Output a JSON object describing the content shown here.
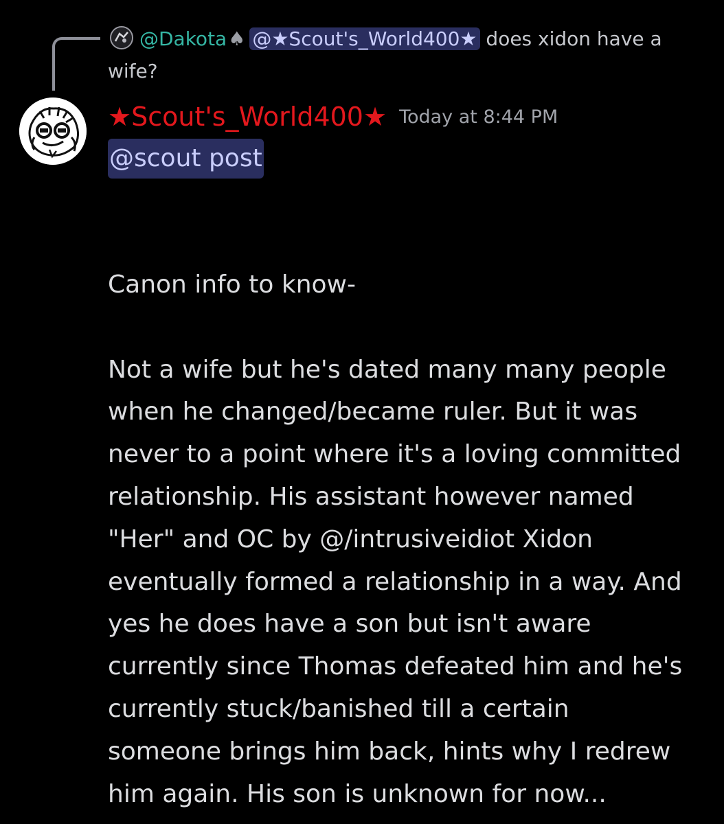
{
  "reply": {
    "author": "@Dakota",
    "author_badge": "♠",
    "mention": "@★Scout's_World400★",
    "text_part1": " does xidon have a",
    "text_part2": "wife?"
  },
  "message": {
    "author": "★Scout's_World400★",
    "author_color": "#e3181d",
    "timestamp": "Today at 8:44 PM",
    "role_mention": "@scout post",
    "heading": "Canon info to know-",
    "body": "Not a wife but he's dated many many people\nwhen he changed/became ruler. But it was\nnever to a point where it's a loving committed\nrelationship. His assistant however named\n\"Her\" and OC by @/intrusiveidiot  Xidon\neventually formed a relationship in a way. And\nyes he does have a son but isn't aware\ncurrently since Thomas defeated him and he's\ncurrently stuck/banished till a certain\nsomeone brings him back, hints why I redrew\nhim again. His son is unknown for now..."
  },
  "colors": {
    "background": "#000000",
    "mention_bg": "#2a2e5f",
    "mention_text": "#c9cdfb",
    "reply_author": "#35b6a4"
  }
}
